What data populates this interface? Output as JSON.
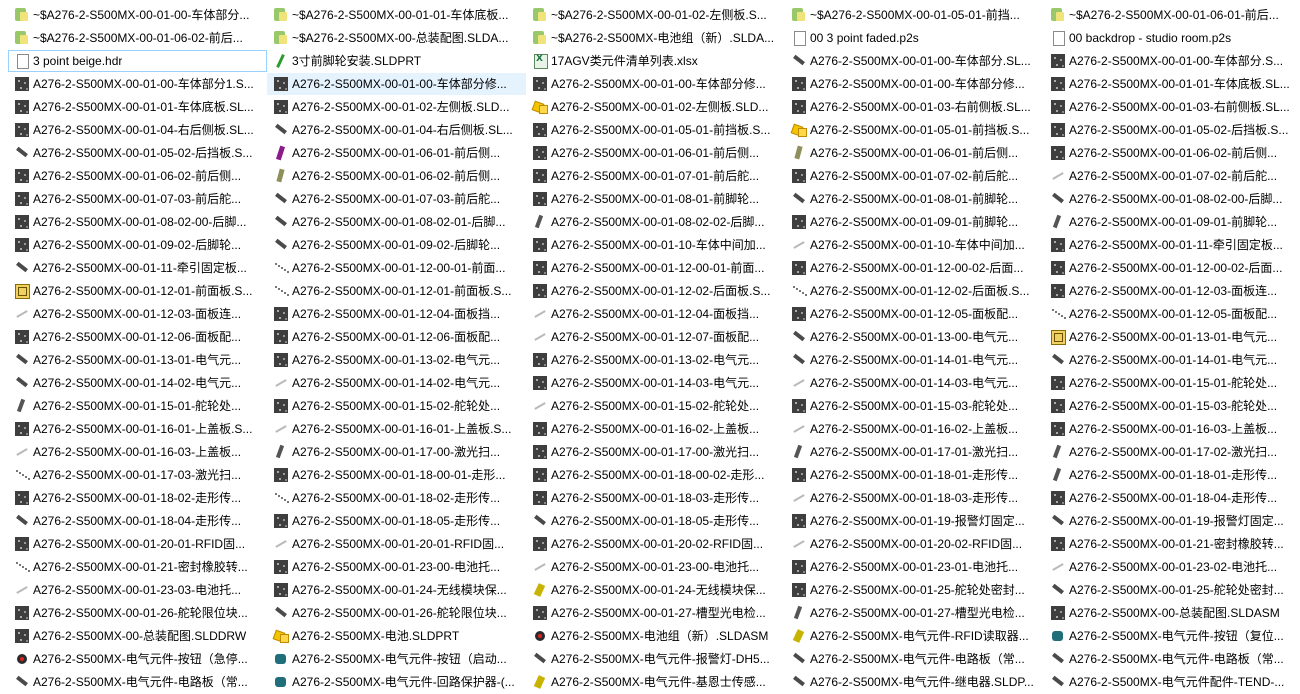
{
  "explorer": {
    "view": "list",
    "items": [
      {
        "name": "~$A276-2-S500MX-00-01-00-车体部分...",
        "icon": "lock-icon",
        "kind": "i-lock"
      },
      {
        "name": "~$A276-2-S500MX-00-01-01-车体底板...",
        "icon": "lock-icon",
        "kind": "i-lock"
      },
      {
        "name": "~$A276-2-S500MX-00-01-02-左侧板.S...",
        "icon": "lock-icon",
        "kind": "i-lock"
      },
      {
        "name": "~$A276-2-S500MX-00-01-05-01-前挡...",
        "icon": "lock-icon",
        "kind": "i-lock"
      },
      {
        "name": "~$A276-2-S500MX-00-01-06-01-前后...",
        "icon": "lock-icon",
        "kind": "i-lock"
      },
      {
        "name": "~$A276-2-S500MX-00-01-06-02-前后...",
        "icon": "lock-icon",
        "kind": "i-lock"
      },
      {
        "name": "~$A276-2-S500MX-00-总装配图.SLDA...",
        "icon": "lock-icon",
        "kind": "i-lock"
      },
      {
        "name": "~$A276-2-S500MX-电池组（新）.SLDA...",
        "icon": "lock-icon",
        "kind": "i-lock"
      },
      {
        "name": "00 3 point faded.p2s",
        "icon": "document-icon",
        "kind": "i-doc"
      },
      {
        "name": "00 backdrop - studio room.p2s",
        "icon": "document-icon",
        "kind": "i-doc"
      },
      {
        "name": "3 point beige.hdr",
        "icon": "document-icon",
        "kind": "i-doc",
        "focused": true
      },
      {
        "name": "3寸前脚轮安装.SLDPRT",
        "icon": "part-icon",
        "kind": "i-sldprt"
      },
      {
        "name": "17AGV类元件清单列表.xlsx",
        "icon": "excel-icon",
        "kind": "i-xls"
      },
      {
        "name": "A276-2-S500MX-00-01-00-车体部分.SL...",
        "icon": "part-icon",
        "kind": "i-part"
      },
      {
        "name": "A276-2-S500MX-00-01-00-车体部分.S...",
        "icon": "part-icon",
        "kind": "i-grey"
      },
      {
        "name": "A276-2-S500MX-00-01-00-车体部分1.S...",
        "icon": "part-icon",
        "kind": "i-grey"
      },
      {
        "name": "A276-2-S500MX-00-01-00-车体部分修...",
        "icon": "part-icon",
        "kind": "i-grey",
        "selected": true
      },
      {
        "name": "A276-2-S500MX-00-01-00-车体部分修...",
        "icon": "part-icon",
        "kind": "i-grey"
      },
      {
        "name": "A276-2-S500MX-00-01-00-车体部分修...",
        "icon": "part-icon",
        "kind": "i-grey"
      },
      {
        "name": "A276-2-S500MX-00-01-01-车体底板.SL...",
        "icon": "part-icon",
        "kind": "i-grey"
      },
      {
        "name": "A276-2-S500MX-00-01-01-车体底板.SL...",
        "icon": "part-icon",
        "kind": "i-grey"
      },
      {
        "name": "A276-2-S500MX-00-01-02-左侧板.SLD...",
        "icon": "part-icon",
        "kind": "i-grey"
      },
      {
        "name": "A276-2-S500MX-00-01-02-左侧板.SLD...",
        "icon": "assembly-icon",
        "kind": "i-asm"
      },
      {
        "name": "A276-2-S500MX-00-01-03-右前侧板.SL...",
        "icon": "part-icon",
        "kind": "i-grey"
      },
      {
        "name": "A276-2-S500MX-00-01-03-右前侧板.SL...",
        "icon": "part-icon",
        "kind": "i-grey"
      },
      {
        "name": "A276-2-S500MX-00-01-04-右后侧板.SL...",
        "icon": "part-icon",
        "kind": "i-grey"
      },
      {
        "name": "A276-2-S500MX-00-01-04-右后侧板.SL...",
        "icon": "part-icon",
        "kind": "i-part"
      },
      {
        "name": "A276-2-S500MX-00-01-05-01-前挡板.S...",
        "icon": "part-icon",
        "kind": "i-grey"
      },
      {
        "name": "A276-2-S500MX-00-01-05-01-前挡板.S...",
        "icon": "assembly-icon",
        "kind": "i-asm"
      },
      {
        "name": "A276-2-S500MX-00-01-05-02-后挡板.S...",
        "icon": "part-icon",
        "kind": "i-grey"
      },
      {
        "name": "A276-2-S500MX-00-01-05-02-后挡板.S...",
        "icon": "part-icon",
        "kind": "i-part"
      },
      {
        "name": "A276-2-S500MX-00-01-06-01-前后侧...",
        "icon": "part-icon",
        "kind": "i-purple"
      },
      {
        "name": "A276-2-S500MX-00-01-06-01-前后侧...",
        "icon": "part-icon",
        "kind": "i-grey"
      },
      {
        "name": "A276-2-S500MX-00-01-06-01-前后侧...",
        "icon": "part-icon",
        "kind": "i-olive"
      },
      {
        "name": "A276-2-S500MX-00-01-06-02-前后侧...",
        "icon": "part-icon",
        "kind": "i-grey"
      },
      {
        "name": "A276-2-S500MX-00-01-06-02-前后侧...",
        "icon": "part-icon",
        "kind": "i-grey"
      },
      {
        "name": "A276-2-S500MX-00-01-06-02-前后侧...",
        "icon": "part-icon",
        "kind": "i-olive"
      },
      {
        "name": "A276-2-S500MX-00-01-07-01-前后舵...",
        "icon": "part-icon",
        "kind": "i-grey"
      },
      {
        "name": "A276-2-S500MX-00-01-07-02-前后舵...",
        "icon": "part-icon",
        "kind": "i-grey"
      },
      {
        "name": "A276-2-S500MX-00-01-07-02-前后舵...",
        "icon": "part-icon",
        "kind": "i-light"
      },
      {
        "name": "A276-2-S500MX-00-01-07-03-前后舵...",
        "icon": "part-icon",
        "kind": "i-grey"
      },
      {
        "name": "A276-2-S500MX-00-01-07-03-前后舵...",
        "icon": "part-icon",
        "kind": "i-part"
      },
      {
        "name": "A276-2-S500MX-00-01-08-01-前脚轮...",
        "icon": "part-icon",
        "kind": "i-grey"
      },
      {
        "name": "A276-2-S500MX-00-01-08-01-前脚轮...",
        "icon": "part-icon",
        "kind": "i-part"
      },
      {
        "name": "A276-2-S500MX-00-01-08-02-00-后脚...",
        "icon": "part-icon",
        "kind": "i-part"
      },
      {
        "name": "A276-2-S500MX-00-01-08-02-00-后脚...",
        "icon": "part-icon",
        "kind": "i-grey"
      },
      {
        "name": "A276-2-S500MX-00-01-08-02-01-后脚...",
        "icon": "part-icon",
        "kind": "i-part"
      },
      {
        "name": "A276-2-S500MX-00-01-08-02-02-后脚...",
        "icon": "part-icon",
        "kind": "i-part2"
      },
      {
        "name": "A276-2-S500MX-00-01-09-01-前脚轮...",
        "icon": "part-icon",
        "kind": "i-grey"
      },
      {
        "name": "A276-2-S500MX-00-01-09-01-前脚轮...",
        "icon": "part-icon",
        "kind": "i-part2"
      },
      {
        "name": "A276-2-S500MX-00-01-09-02-后脚轮...",
        "icon": "part-icon",
        "kind": "i-grey"
      },
      {
        "name": "A276-2-S500MX-00-01-09-02-后脚轮...",
        "icon": "part-icon",
        "kind": "i-part"
      },
      {
        "name": "A276-2-S500MX-00-01-10-车体中间加...",
        "icon": "part-icon",
        "kind": "i-grey"
      },
      {
        "name": "A276-2-S500MX-00-01-10-车体中间加...",
        "icon": "part-icon",
        "kind": "i-light"
      },
      {
        "name": "A276-2-S500MX-00-01-11-牵引固定板...",
        "icon": "part-icon",
        "kind": "i-grey"
      },
      {
        "name": "A276-2-S500MX-00-01-11-牵引固定板...",
        "icon": "part-icon",
        "kind": "i-part"
      },
      {
        "name": "A276-2-S500MX-00-01-12-00-01-前面...",
        "icon": "part-icon",
        "kind": "i-dots"
      },
      {
        "name": "A276-2-S500MX-00-01-12-00-01-前面...",
        "icon": "part-icon",
        "kind": "i-grey"
      },
      {
        "name": "A276-2-S500MX-00-01-12-00-02-后面...",
        "icon": "part-icon",
        "kind": "i-grey"
      },
      {
        "name": "A276-2-S500MX-00-01-12-00-02-后面...",
        "icon": "part-icon",
        "kind": "i-grey"
      },
      {
        "name": "A276-2-S500MX-00-01-12-01-前面板.S...",
        "icon": "drawing-icon",
        "kind": "i-dwg"
      },
      {
        "name": "A276-2-S500MX-00-01-12-01-前面板.S...",
        "icon": "part-icon",
        "kind": "i-dots"
      },
      {
        "name": "A276-2-S500MX-00-01-12-02-后面板.S...",
        "icon": "part-icon",
        "kind": "i-grey"
      },
      {
        "name": "A276-2-S500MX-00-01-12-02-后面板.S...",
        "icon": "part-icon",
        "kind": "i-dots"
      },
      {
        "name": "A276-2-S500MX-00-01-12-03-面板连...",
        "icon": "part-icon",
        "kind": "i-grey"
      },
      {
        "name": "A276-2-S500MX-00-01-12-03-面板连...",
        "icon": "part-icon",
        "kind": "i-light"
      },
      {
        "name": "A276-2-S500MX-00-01-12-04-面板挡...",
        "icon": "part-icon",
        "kind": "i-grey"
      },
      {
        "name": "A276-2-S500MX-00-01-12-04-面板挡...",
        "icon": "part-icon",
        "kind": "i-light"
      },
      {
        "name": "A276-2-S500MX-00-01-12-05-面板配...",
        "icon": "part-icon",
        "kind": "i-grey"
      },
      {
        "name": "A276-2-S500MX-00-01-12-05-面板配...",
        "icon": "part-icon",
        "kind": "i-dots"
      },
      {
        "name": "A276-2-S500MX-00-01-12-06-面板配...",
        "icon": "part-icon",
        "kind": "i-grey"
      },
      {
        "name": "A276-2-S500MX-00-01-12-06-面板配...",
        "icon": "part-icon",
        "kind": "i-grey"
      },
      {
        "name": "A276-2-S500MX-00-01-12-07-面板配...",
        "icon": "part-icon",
        "kind": "i-light"
      },
      {
        "name": "A276-2-S500MX-00-01-13-00-电气元...",
        "icon": "part-icon",
        "kind": "i-part"
      },
      {
        "name": "A276-2-S500MX-00-01-13-01-电气元...",
        "icon": "drawing-icon",
        "kind": "i-dwg"
      },
      {
        "name": "A276-2-S500MX-00-01-13-01-电气元...",
        "icon": "part-icon",
        "kind": "i-part"
      },
      {
        "name": "A276-2-S500MX-00-01-13-02-电气元...",
        "icon": "part-icon",
        "kind": "i-grey"
      },
      {
        "name": "A276-2-S500MX-00-01-13-02-电气元...",
        "icon": "part-icon",
        "kind": "i-grey"
      },
      {
        "name": "A276-2-S500MX-00-01-14-01-电气元...",
        "icon": "part-icon",
        "kind": "i-part"
      },
      {
        "name": "A276-2-S500MX-00-01-14-01-电气元...",
        "icon": "part-icon",
        "kind": "i-part"
      },
      {
        "name": "A276-2-S500MX-00-01-14-02-电气元...",
        "icon": "part-icon",
        "kind": "i-part"
      },
      {
        "name": "A276-2-S500MX-00-01-14-02-电气元...",
        "icon": "part-icon",
        "kind": "i-light"
      },
      {
        "name": "A276-2-S500MX-00-01-14-03-电气元...",
        "icon": "part-icon",
        "kind": "i-grey"
      },
      {
        "name": "A276-2-S500MX-00-01-14-03-电气元...",
        "icon": "part-icon",
        "kind": "i-light"
      },
      {
        "name": "A276-2-S500MX-00-01-15-01-舵轮处...",
        "icon": "part-icon",
        "kind": "i-grey"
      },
      {
        "name": "A276-2-S500MX-00-01-15-01-舵轮处...",
        "icon": "part-icon",
        "kind": "i-part2"
      },
      {
        "name": "A276-2-S500MX-00-01-15-02-舵轮处...",
        "icon": "part-icon",
        "kind": "i-grey"
      },
      {
        "name": "A276-2-S500MX-00-01-15-02-舵轮处...",
        "icon": "part-icon",
        "kind": "i-light"
      },
      {
        "name": "A276-2-S500MX-00-01-15-03-舵轮处...",
        "icon": "part-icon",
        "kind": "i-grey"
      },
      {
        "name": "A276-2-S500MX-00-01-15-03-舵轮处...",
        "icon": "part-icon",
        "kind": "i-grey"
      },
      {
        "name": "A276-2-S500MX-00-01-16-01-上盖板.S...",
        "icon": "part-icon",
        "kind": "i-grey"
      },
      {
        "name": "A276-2-S500MX-00-01-16-01-上盖板.S...",
        "icon": "part-icon",
        "kind": "i-light"
      },
      {
        "name": "A276-2-S500MX-00-01-16-02-上盖板...",
        "icon": "part-icon",
        "kind": "i-grey"
      },
      {
        "name": "A276-2-S500MX-00-01-16-02-上盖板...",
        "icon": "part-icon",
        "kind": "i-light"
      },
      {
        "name": "A276-2-S500MX-00-01-16-03-上盖板...",
        "icon": "part-icon",
        "kind": "i-grey"
      },
      {
        "name": "A276-2-S500MX-00-01-16-03-上盖板...",
        "icon": "part-icon",
        "kind": "i-light"
      },
      {
        "name": "A276-2-S500MX-00-01-17-00-激光扫...",
        "icon": "part-icon",
        "kind": "i-part2"
      },
      {
        "name": "A276-2-S500MX-00-01-17-00-激光扫...",
        "icon": "part-icon",
        "kind": "i-grey"
      },
      {
        "name": "A276-2-S500MX-00-01-17-01-激光扫...",
        "icon": "part-icon",
        "kind": "i-part2"
      },
      {
        "name": "A276-2-S500MX-00-01-17-02-激光扫...",
        "icon": "part-icon",
        "kind": "i-part2"
      },
      {
        "name": "A276-2-S500MX-00-01-17-03-激光扫...",
        "icon": "part-icon",
        "kind": "i-dots"
      },
      {
        "name": "A276-2-S500MX-00-01-18-00-01-走形...",
        "icon": "part-icon",
        "kind": "i-grey"
      },
      {
        "name": "A276-2-S500MX-00-01-18-00-02-走形...",
        "icon": "part-icon",
        "kind": "i-grey"
      },
      {
        "name": "A276-2-S500MX-00-01-18-01-走形传...",
        "icon": "part-icon",
        "kind": "i-grey"
      },
      {
        "name": "A276-2-S500MX-00-01-18-01-走形传...",
        "icon": "part-icon",
        "kind": "i-part2"
      },
      {
        "name": "A276-2-S500MX-00-01-18-02-走形传...",
        "icon": "part-icon",
        "kind": "i-grey"
      },
      {
        "name": "A276-2-S500MX-00-01-18-02-走形传...",
        "icon": "part-icon",
        "kind": "i-dots"
      },
      {
        "name": "A276-2-S500MX-00-01-18-03-走形传...",
        "icon": "part-icon",
        "kind": "i-grey"
      },
      {
        "name": "A276-2-S500MX-00-01-18-03-走形传...",
        "icon": "part-icon",
        "kind": "i-light"
      },
      {
        "name": "A276-2-S500MX-00-01-18-04-走形传...",
        "icon": "part-icon",
        "kind": "i-grey"
      },
      {
        "name": "A276-2-S500MX-00-01-18-04-走形传...",
        "icon": "part-icon",
        "kind": "i-part"
      },
      {
        "name": "A276-2-S500MX-00-01-18-05-走形传...",
        "icon": "part-icon",
        "kind": "i-grey"
      },
      {
        "name": "A276-2-S500MX-00-01-18-05-走形传...",
        "icon": "part-icon",
        "kind": "i-part"
      },
      {
        "name": "A276-2-S500MX-00-01-19-报警灯固定...",
        "icon": "part-icon",
        "kind": "i-grey"
      },
      {
        "name": "A276-2-S500MX-00-01-19-报警灯固定...",
        "icon": "part-icon",
        "kind": "i-part"
      },
      {
        "name": "A276-2-S500MX-00-01-20-01-RFID固...",
        "icon": "part-icon",
        "kind": "i-grey"
      },
      {
        "name": "A276-2-S500MX-00-01-20-01-RFID固...",
        "icon": "part-icon",
        "kind": "i-light"
      },
      {
        "name": "A276-2-S500MX-00-01-20-02-RFID固...",
        "icon": "part-icon",
        "kind": "i-grey"
      },
      {
        "name": "A276-2-S500MX-00-01-20-02-RFID固...",
        "icon": "part-icon",
        "kind": "i-light"
      },
      {
        "name": "A276-2-S500MX-00-01-21-密封橡胶转...",
        "icon": "part-icon",
        "kind": "i-grey"
      },
      {
        "name": "A276-2-S500MX-00-01-21-密封橡胶转...",
        "icon": "part-icon",
        "kind": "i-dots"
      },
      {
        "name": "A276-2-S500MX-00-01-23-00-电池托...",
        "icon": "part-icon",
        "kind": "i-grey"
      },
      {
        "name": "A276-2-S500MX-00-01-23-00-电池托...",
        "icon": "part-icon",
        "kind": "i-light"
      },
      {
        "name": "A276-2-S500MX-00-01-23-01-电池托...",
        "icon": "part-icon",
        "kind": "i-grey"
      },
      {
        "name": "A276-2-S500MX-00-01-23-02-电池托...",
        "icon": "part-icon",
        "kind": "i-light"
      },
      {
        "name": "A276-2-S500MX-00-01-23-03-电池托...",
        "icon": "part-icon",
        "kind": "i-light"
      },
      {
        "name": "A276-2-S500MX-00-01-24-无线模块保...",
        "icon": "part-icon",
        "kind": "i-grey"
      },
      {
        "name": "A276-2-S500MX-00-01-24-无线模块保...",
        "icon": "part-icon",
        "kind": "i-yellowblk"
      },
      {
        "name": "A276-2-S500MX-00-01-25-舵轮处密封...",
        "icon": "part-icon",
        "kind": "i-grey"
      },
      {
        "name": "A276-2-S500MX-00-01-25-舵轮处密封...",
        "icon": "part-icon",
        "kind": "i-part"
      },
      {
        "name": "A276-2-S500MX-00-01-26-舵轮限位块...",
        "icon": "part-icon",
        "kind": "i-grey"
      },
      {
        "name": "A276-2-S500MX-00-01-26-舵轮限位块...",
        "icon": "part-icon",
        "kind": "i-part"
      },
      {
        "name": "A276-2-S500MX-00-01-27-槽型光电检...",
        "icon": "part-icon",
        "kind": "i-grey"
      },
      {
        "name": "A276-2-S500MX-00-01-27-槽型光电检...",
        "icon": "part-icon",
        "kind": "i-part2"
      },
      {
        "name": "A276-2-S500MX-00-总装配图.SLDASM",
        "icon": "part-icon",
        "kind": "i-grey"
      },
      {
        "name": "A276-2-S500MX-00-总装配图.SLDDRW",
        "icon": "part-icon",
        "kind": "i-grey"
      },
      {
        "name": "A276-2-S500MX-电池.SLDPRT",
        "icon": "assembly-icon",
        "kind": "i-asm"
      },
      {
        "name": "A276-2-S500MX-电池组（新）.SLDASM",
        "icon": "part-icon",
        "kind": "i-red"
      },
      {
        "name": "A276-2-S500MX-电气元件-RFID读取器...",
        "icon": "part-icon",
        "kind": "i-yellowblk"
      },
      {
        "name": "A276-2-S500MX-电气元件-按钮（复位...",
        "icon": "part-icon",
        "kind": "i-teal"
      },
      {
        "name": "A276-2-S500MX-电气元件-按钮（急停...",
        "icon": "part-icon",
        "kind": "i-red"
      },
      {
        "name": "A276-2-S500MX-电气元件-按钮（启动...",
        "icon": "part-icon",
        "kind": "i-teal"
      },
      {
        "name": "A276-2-S500MX-电气元件-报警灯-DH5...",
        "icon": "part-icon",
        "kind": "i-part"
      },
      {
        "name": "A276-2-S500MX-电气元件-电路板（常...",
        "icon": "part-icon",
        "kind": "i-part"
      },
      {
        "name": "A276-2-S500MX-电气元件-电路板（常...",
        "icon": "part-icon",
        "kind": "i-part"
      },
      {
        "name": "A276-2-S500MX-电气元件-电路板（常...",
        "icon": "part-icon",
        "kind": "i-part"
      },
      {
        "name": "A276-2-S500MX-电气元件-回路保护器-(...",
        "icon": "part-icon",
        "kind": "i-teal"
      },
      {
        "name": "A276-2-S500MX-电气元件-基恩士传感...",
        "icon": "part-icon",
        "kind": "i-yellowblk"
      },
      {
        "name": "A276-2-S500MX-电气元件-继电器.SLDP...",
        "icon": "part-icon",
        "kind": "i-part"
      },
      {
        "name": "A276-2-S500MX-电气元件配件-TEND-...",
        "icon": "part-icon",
        "kind": "i-part"
      }
    ]
  }
}
